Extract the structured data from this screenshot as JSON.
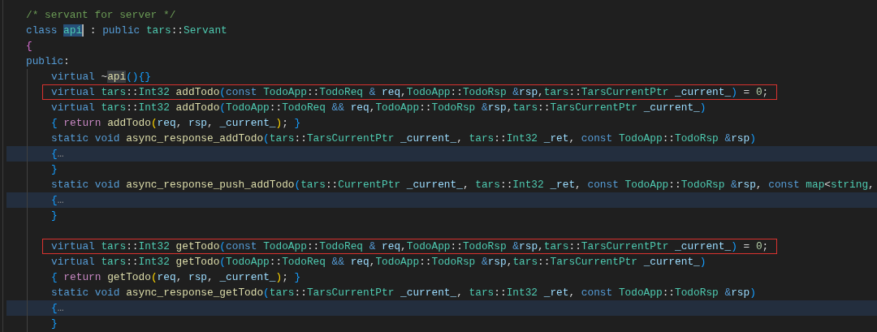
{
  "editor": {
    "lines": [
      {
        "boxed": false,
        "highlighted": false,
        "tokens": [
          {
            "text": "/* servant for server */",
            "kind": "comment"
          }
        ]
      },
      {
        "boxed": false,
        "highlighted": false,
        "tokens": [
          {
            "text": "class ",
            "kind": "kw"
          },
          {
            "text": "api",
            "kind": "sel"
          },
          {
            "text": " : ",
            "kind": "punct"
          },
          {
            "text": "public ",
            "kind": "kw"
          },
          {
            "text": "tars",
            "kind": "type"
          },
          {
            "text": "::",
            "kind": "punct"
          },
          {
            "text": "Servant",
            "kind": "type"
          }
        ]
      },
      {
        "boxed": false,
        "highlighted": false,
        "tokens": [
          {
            "text": "{",
            "kind": "br3"
          }
        ]
      },
      {
        "boxed": false,
        "highlighted": false,
        "tokens": [
          {
            "text": "public",
            "kind": "kw"
          },
          {
            "text": ":",
            "kind": "punct"
          }
        ],
        "children": [
          {
            "boxed": false,
            "highlighted": false,
            "space_above": false,
            "tokens": [
              {
                "text": "virtual ",
                "kind": "kw"
              },
              {
                "text": "~",
                "kind": "punct"
              },
              {
                "text": "api",
                "kind": "match"
              },
              {
                "text": "(){}",
                "kind": "br"
              }
            ]
          },
          {
            "boxed": true,
            "highlighted": false,
            "space_above": false,
            "tokens": [
              {
                "text": "virtual ",
                "kind": "kw"
              },
              {
                "text": "tars",
                "kind": "type"
              },
              {
                "text": "::",
                "kind": "punct"
              },
              {
                "text": "Int32 ",
                "kind": "type"
              },
              {
                "text": "addTodo",
                "kind": "fn"
              },
              {
                "text": "(",
                "kind": "br"
              },
              {
                "text": "const ",
                "kind": "kw"
              },
              {
                "text": "TodoApp",
                "kind": "type"
              },
              {
                "text": "::",
                "kind": "punct"
              },
              {
                "text": "TodoReq ",
                "kind": "type"
              },
              {
                "text": "& ",
                "kind": "kw"
              },
              {
                "text": "req",
                "kind": "var"
              },
              {
                "text": ",",
                "kind": "punct"
              },
              {
                "text": "TodoApp",
                "kind": "type"
              },
              {
                "text": "::",
                "kind": "punct"
              },
              {
                "text": "TodoRsp ",
                "kind": "type"
              },
              {
                "text": "&",
                "kind": "kw"
              },
              {
                "text": "rsp",
                "kind": "var"
              },
              {
                "text": ",",
                "kind": "punct"
              },
              {
                "text": "tars",
                "kind": "type"
              },
              {
                "text": "::",
                "kind": "punct"
              },
              {
                "text": "TarsCurrentPtr ",
                "kind": "type"
              },
              {
                "text": "_current_",
                "kind": "var"
              },
              {
                "text": ")",
                "kind": "br"
              },
              {
                "text": " = ",
                "kind": "punct"
              },
              {
                "text": "0",
                "kind": "num"
              },
              {
                "text": ";",
                "kind": "punct"
              }
            ]
          },
          {
            "boxed": false,
            "highlighted": false,
            "space_above": false,
            "tokens": [
              {
                "text": "virtual ",
                "kind": "kw"
              },
              {
                "text": "tars",
                "kind": "type"
              },
              {
                "text": "::",
                "kind": "punct"
              },
              {
                "text": "Int32 ",
                "kind": "type"
              },
              {
                "text": "addTodo",
                "kind": "fn"
              },
              {
                "text": "(",
                "kind": "br"
              },
              {
                "text": "TodoApp",
                "kind": "type"
              },
              {
                "text": "::",
                "kind": "punct"
              },
              {
                "text": "TodoReq ",
                "kind": "type"
              },
              {
                "text": "&& ",
                "kind": "kw"
              },
              {
                "text": "req",
                "kind": "var"
              },
              {
                "text": ",",
                "kind": "punct"
              },
              {
                "text": "TodoApp",
                "kind": "type"
              },
              {
                "text": "::",
                "kind": "punct"
              },
              {
                "text": "TodoRsp ",
                "kind": "type"
              },
              {
                "text": "&",
                "kind": "kw"
              },
              {
                "text": "rsp",
                "kind": "var"
              },
              {
                "text": ",",
                "kind": "punct"
              },
              {
                "text": "tars",
                "kind": "type"
              },
              {
                "text": "::",
                "kind": "punct"
              },
              {
                "text": "TarsCurrentPtr ",
                "kind": "type"
              },
              {
                "text": "_current_",
                "kind": "var"
              },
              {
                "text": ")",
                "kind": "br"
              }
            ]
          },
          {
            "boxed": false,
            "highlighted": false,
            "space_above": false,
            "tokens": [
              {
                "text": "{ ",
                "kind": "br"
              },
              {
                "text": "return ",
                "kind": "ctrl"
              },
              {
                "text": "addTodo",
                "kind": "fn"
              },
              {
                "text": "(",
                "kind": "br2"
              },
              {
                "text": "req",
                "kind": "var"
              },
              {
                "text": ", ",
                "kind": "punct"
              },
              {
                "text": "rsp",
                "kind": "var"
              },
              {
                "text": ", ",
                "kind": "punct"
              },
              {
                "text": "_current_",
                "kind": "var"
              },
              {
                "text": ")",
                "kind": "br2"
              },
              {
                "text": "; ",
                "kind": "punct"
              },
              {
                "text": "}",
                "kind": "br"
              }
            ]
          },
          {
            "boxed": false,
            "highlighted": false,
            "space_above": false,
            "tokens": [
              {
                "text": "static void ",
                "kind": "kw"
              },
              {
                "text": "async_response_addTodo",
                "kind": "fn"
              },
              {
                "text": "(",
                "kind": "br"
              },
              {
                "text": "tars",
                "kind": "type"
              },
              {
                "text": "::",
                "kind": "punct"
              },
              {
                "text": "TarsCurrentPtr ",
                "kind": "type"
              },
              {
                "text": "_current_",
                "kind": "var"
              },
              {
                "text": ", ",
                "kind": "punct"
              },
              {
                "text": "tars",
                "kind": "type"
              },
              {
                "text": "::",
                "kind": "punct"
              },
              {
                "text": "Int32 ",
                "kind": "type"
              },
              {
                "text": "_ret",
                "kind": "var"
              },
              {
                "text": ", ",
                "kind": "punct"
              },
              {
                "text": "const ",
                "kind": "kw"
              },
              {
                "text": "TodoApp",
                "kind": "type"
              },
              {
                "text": "::",
                "kind": "punct"
              },
              {
                "text": "TodoRsp ",
                "kind": "type"
              },
              {
                "text": "&",
                "kind": "kw"
              },
              {
                "text": "rsp",
                "kind": "var"
              },
              {
                "text": ")",
                "kind": "br"
              }
            ]
          },
          {
            "boxed": false,
            "highlighted": true,
            "space_above": false,
            "tokens": [
              {
                "text": "{",
                "kind": "br"
              },
              {
                "text": "…",
                "kind": "fold"
              }
            ]
          },
          {
            "boxed": false,
            "highlighted": false,
            "space_above": false,
            "tokens": [
              {
                "text": "}",
                "kind": "br"
              }
            ]
          },
          {
            "boxed": false,
            "highlighted": false,
            "space_above": false,
            "tokens": [
              {
                "text": "static void ",
                "kind": "kw"
              },
              {
                "text": "async_response_push_addTodo",
                "kind": "fn"
              },
              {
                "text": "(",
                "kind": "br"
              },
              {
                "text": "tars",
                "kind": "type"
              },
              {
                "text": "::",
                "kind": "punct"
              },
              {
                "text": "CurrentPtr ",
                "kind": "type"
              },
              {
                "text": "_current_",
                "kind": "var"
              },
              {
                "text": ", ",
                "kind": "punct"
              },
              {
                "text": "tars",
                "kind": "type"
              },
              {
                "text": "::",
                "kind": "punct"
              },
              {
                "text": "Int32 ",
                "kind": "type"
              },
              {
                "text": "_ret",
                "kind": "var"
              },
              {
                "text": ", ",
                "kind": "punct"
              },
              {
                "text": "const ",
                "kind": "kw"
              },
              {
                "text": "TodoApp",
                "kind": "type"
              },
              {
                "text": "::",
                "kind": "punct"
              },
              {
                "text": "TodoRsp ",
                "kind": "type"
              },
              {
                "text": "&",
                "kind": "kw"
              },
              {
                "text": "rsp",
                "kind": "var"
              },
              {
                "text": ", ",
                "kind": "punct"
              },
              {
                "text": "const ",
                "kind": "kw"
              },
              {
                "text": "map",
                "kind": "type"
              },
              {
                "text": "<",
                "kind": "punct"
              },
              {
                "text": "string",
                "kind": "type"
              },
              {
                "text": ",",
                "kind": "punct"
              }
            ]
          },
          {
            "boxed": false,
            "highlighted": true,
            "space_above": false,
            "tokens": [
              {
                "text": "{",
                "kind": "br"
              },
              {
                "text": "…",
                "kind": "fold"
              }
            ]
          },
          {
            "boxed": false,
            "highlighted": false,
            "space_above": false,
            "tokens": [
              {
                "text": "}",
                "kind": "br"
              }
            ]
          },
          {
            "boxed": true,
            "highlighted": false,
            "space_above": true,
            "tokens": [
              {
                "text": "virtual ",
                "kind": "kw"
              },
              {
                "text": "tars",
                "kind": "type"
              },
              {
                "text": "::",
                "kind": "punct"
              },
              {
                "text": "Int32 ",
                "kind": "type"
              },
              {
                "text": "getTodo",
                "kind": "fn"
              },
              {
                "text": "(",
                "kind": "br"
              },
              {
                "text": "const ",
                "kind": "kw"
              },
              {
                "text": "TodoApp",
                "kind": "type"
              },
              {
                "text": "::",
                "kind": "punct"
              },
              {
                "text": "TodoReq ",
                "kind": "type"
              },
              {
                "text": "& ",
                "kind": "kw"
              },
              {
                "text": "req",
                "kind": "var"
              },
              {
                "text": ",",
                "kind": "punct"
              },
              {
                "text": "TodoApp",
                "kind": "type"
              },
              {
                "text": "::",
                "kind": "punct"
              },
              {
                "text": "TodoRsp ",
                "kind": "type"
              },
              {
                "text": "&",
                "kind": "kw"
              },
              {
                "text": "rsp",
                "kind": "var"
              },
              {
                "text": ",",
                "kind": "punct"
              },
              {
                "text": "tars",
                "kind": "type"
              },
              {
                "text": "::",
                "kind": "punct"
              },
              {
                "text": "TarsCurrentPtr ",
                "kind": "type"
              },
              {
                "text": "_current_",
                "kind": "var"
              },
              {
                "text": ")",
                "kind": "br"
              },
              {
                "text": " = ",
                "kind": "punct"
              },
              {
                "text": "0",
                "kind": "num"
              },
              {
                "text": ";",
                "kind": "punct"
              }
            ]
          },
          {
            "boxed": false,
            "highlighted": false,
            "space_above": false,
            "tokens": [
              {
                "text": "virtual ",
                "kind": "kw"
              },
              {
                "text": "tars",
                "kind": "type"
              },
              {
                "text": "::",
                "kind": "punct"
              },
              {
                "text": "Int32 ",
                "kind": "type"
              },
              {
                "text": "getTodo",
                "kind": "fn"
              },
              {
                "text": "(",
                "kind": "br"
              },
              {
                "text": "TodoApp",
                "kind": "type"
              },
              {
                "text": "::",
                "kind": "punct"
              },
              {
                "text": "TodoReq ",
                "kind": "type"
              },
              {
                "text": "&& ",
                "kind": "kw"
              },
              {
                "text": "req",
                "kind": "var"
              },
              {
                "text": ",",
                "kind": "punct"
              },
              {
                "text": "TodoApp",
                "kind": "type"
              },
              {
                "text": "::",
                "kind": "punct"
              },
              {
                "text": "TodoRsp ",
                "kind": "type"
              },
              {
                "text": "&",
                "kind": "kw"
              },
              {
                "text": "rsp",
                "kind": "var"
              },
              {
                "text": ",",
                "kind": "punct"
              },
              {
                "text": "tars",
                "kind": "type"
              },
              {
                "text": "::",
                "kind": "punct"
              },
              {
                "text": "TarsCurrentPtr ",
                "kind": "type"
              },
              {
                "text": "_current_",
                "kind": "var"
              },
              {
                "text": ")",
                "kind": "br"
              }
            ]
          },
          {
            "boxed": false,
            "highlighted": false,
            "space_above": false,
            "tokens": [
              {
                "text": "{ ",
                "kind": "br"
              },
              {
                "text": "return ",
                "kind": "ctrl"
              },
              {
                "text": "getTodo",
                "kind": "fn"
              },
              {
                "text": "(",
                "kind": "br2"
              },
              {
                "text": "req",
                "kind": "var"
              },
              {
                "text": ", ",
                "kind": "punct"
              },
              {
                "text": "rsp",
                "kind": "var"
              },
              {
                "text": ", ",
                "kind": "punct"
              },
              {
                "text": "_current_",
                "kind": "var"
              },
              {
                "text": ")",
                "kind": "br2"
              },
              {
                "text": "; ",
                "kind": "punct"
              },
              {
                "text": "}",
                "kind": "br"
              }
            ]
          },
          {
            "boxed": false,
            "highlighted": false,
            "space_above": false,
            "tokens": [
              {
                "text": "static void ",
                "kind": "kw"
              },
              {
                "text": "async_response_getTodo",
                "kind": "fn"
              },
              {
                "text": "(",
                "kind": "br"
              },
              {
                "text": "tars",
                "kind": "type"
              },
              {
                "text": "::",
                "kind": "punct"
              },
              {
                "text": "TarsCurrentPtr ",
                "kind": "type"
              },
              {
                "text": "_current_",
                "kind": "var"
              },
              {
                "text": ", ",
                "kind": "punct"
              },
              {
                "text": "tars",
                "kind": "type"
              },
              {
                "text": "::",
                "kind": "punct"
              },
              {
                "text": "Int32 ",
                "kind": "type"
              },
              {
                "text": "_ret",
                "kind": "var"
              },
              {
                "text": ", ",
                "kind": "punct"
              },
              {
                "text": "const ",
                "kind": "kw"
              },
              {
                "text": "TodoApp",
                "kind": "type"
              },
              {
                "text": "::",
                "kind": "punct"
              },
              {
                "text": "TodoRsp ",
                "kind": "type"
              },
              {
                "text": "&",
                "kind": "kw"
              },
              {
                "text": "rsp",
                "kind": "var"
              },
              {
                "text": ")",
                "kind": "br"
              }
            ]
          },
          {
            "boxed": false,
            "highlighted": true,
            "space_above": false,
            "tokens": [
              {
                "text": "{",
                "kind": "br"
              },
              {
                "text": "…",
                "kind": "fold"
              }
            ]
          },
          {
            "boxed": false,
            "highlighted": false,
            "space_above": false,
            "tokens": [
              {
                "text": "}",
                "kind": "br"
              }
            ]
          }
        ]
      }
    ]
  }
}
